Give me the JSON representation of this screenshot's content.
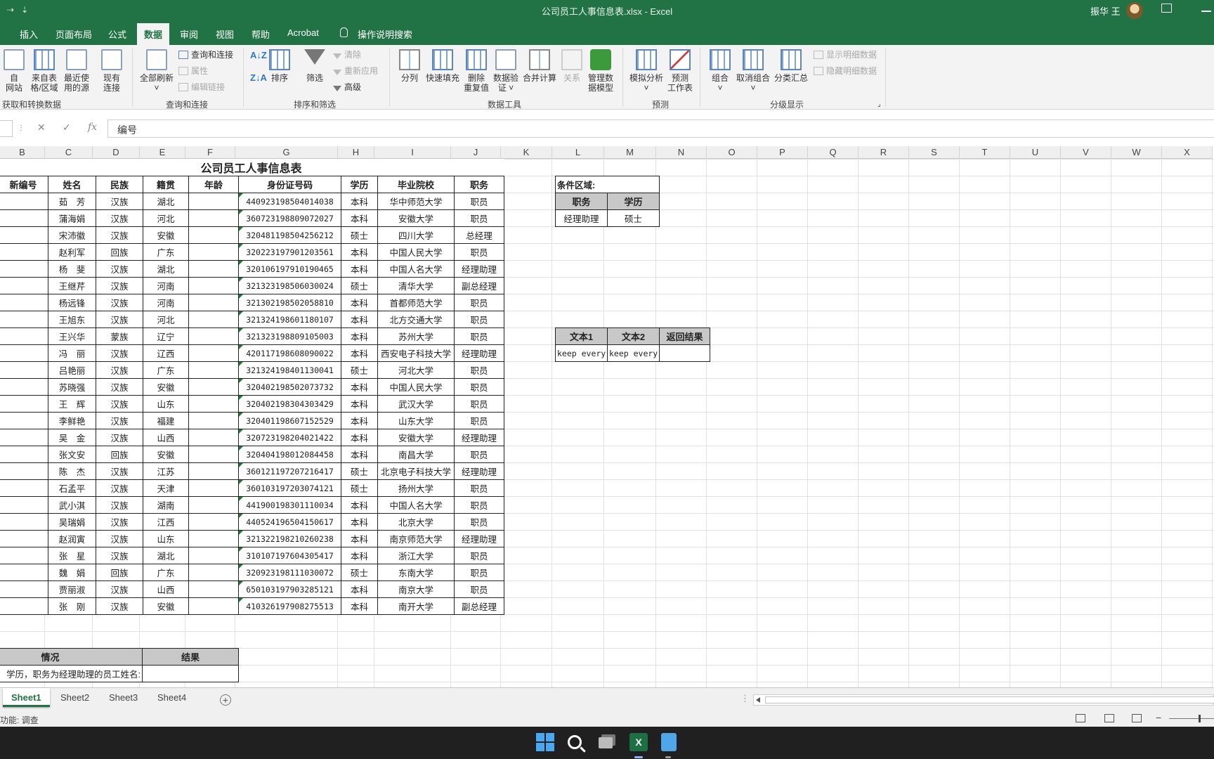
{
  "window": {
    "title": "公司员工人事信息表.xlsx  -  Excel",
    "user": "振华 王"
  },
  "tabs": [
    "插入",
    "页面布局",
    "公式",
    "数据",
    "审阅",
    "视图",
    "帮助",
    "Acrobat",
    "操作说明搜索"
  ],
  "active_tab": "数据",
  "ribbon": {
    "get_data": {
      "web": "自\n网站",
      "table": "来自表\n格/区域",
      "recent": "最近使\n用的源",
      "existing": "现有\n连接",
      "label": "获取和转换数据"
    },
    "queries": {
      "refresh_all": "全部刷新",
      "queries_connections": "查询和连接",
      "properties": "属性",
      "edit_links": "编辑链接",
      "label": "查询和连接"
    },
    "sort_filter": {
      "sort": "排序",
      "filter": "筛选",
      "clear": "清除",
      "reapply": "重新应用",
      "advanced": "高级",
      "label": "排序和筛选"
    },
    "data_tools": {
      "text_to_columns": "分列",
      "flash_fill": "快速填充",
      "remove_dup": "删除\n重复值",
      "validation": "数据验\n证 ˅",
      "consolidate": "合并计算",
      "relationships": "关系",
      "data_model": "管理数\n据模型",
      "label": "数据工具"
    },
    "forecast": {
      "what_if": "模拟分析\n˅",
      "sheet": "预测\n工作表",
      "label": "预测"
    },
    "outline": {
      "group": "组合\n˅",
      "ungroup": "取消组合\n˅",
      "subtotal": "分类汇总",
      "show_detail": "显示明细数据",
      "hide_detail": "隐藏明细数据",
      "label": "分级显示"
    }
  },
  "formula_bar": {
    "content": "编号",
    "cancel": "✕",
    "enter": "✓",
    "fx": "fx"
  },
  "columns": [
    "B",
    "C",
    "D",
    "E",
    "F",
    "G",
    "H",
    "I",
    "J",
    "K",
    "L",
    "M",
    "N",
    "O",
    "P",
    "Q",
    "R",
    "S",
    "T",
    "U",
    "V",
    "W",
    "X"
  ],
  "main_table": {
    "title": "公司员工人事信息表",
    "headers": [
      "新编号",
      "姓名",
      "民族",
      "籍贯",
      "年龄",
      "身份证号码",
      "学历",
      "毕业院校",
      "职务"
    ],
    "rows": [
      [
        "",
        "茹　芳",
        "汉族",
        "湖北",
        "",
        "440923198504014038",
        "本科",
        "华中师范大学",
        "职员"
      ],
      [
        "",
        "蒲海娟",
        "汉族",
        "河北",
        "",
        "360723198809072027",
        "本科",
        "安徽大学",
        "职员"
      ],
      [
        "",
        "宋沛徽",
        "汉族",
        "安徽",
        "",
        "320481198504256212",
        "硕士",
        "四川大学",
        "总经理"
      ],
      [
        "",
        "赵利军",
        "回族",
        "广东",
        "",
        "320223197901203561",
        "本科",
        "中国人民大学",
        "职员"
      ],
      [
        "",
        "杨　斐",
        "汉族",
        "湖北",
        "",
        "320106197910190465",
        "本科",
        "中国人名大学",
        "经理助理"
      ],
      [
        "",
        "王继芹",
        "汉族",
        "河南",
        "",
        "321323198506030024",
        "硕士",
        "清华大学",
        "副总经理"
      ],
      [
        "",
        "杨远锋",
        "汉族",
        "河南",
        "",
        "321302198502058810",
        "本科",
        "首都师范大学",
        "职员"
      ],
      [
        "",
        "王旭东",
        "汉族",
        "河北",
        "",
        "321324198601180107",
        "本科",
        "北方交通大学",
        "职员"
      ],
      [
        "",
        "王兴华",
        "蒙族",
        "辽宁",
        "",
        "321323198809105003",
        "本科",
        "苏州大学",
        "职员"
      ],
      [
        "",
        "冯　丽",
        "汉族",
        "辽西",
        "",
        "420117198608090022",
        "本科",
        "西安电子科技大学",
        "经理助理"
      ],
      [
        "",
        "吕艳丽",
        "汉族",
        "广东",
        "",
        "321324198401130041",
        "硕士",
        "河北大学",
        "职员"
      ],
      [
        "",
        "苏晓强",
        "汉族",
        "安徽",
        "",
        "320402198502073732",
        "本科",
        "中国人民大学",
        "职员"
      ],
      [
        "",
        "王　辉",
        "汉族",
        "山东",
        "",
        "320402198304303429",
        "本科",
        "武汉大学",
        "职员"
      ],
      [
        "",
        "李鲜艳",
        "汉族",
        "福建",
        "",
        "320401198607152529",
        "本科",
        "山东大学",
        "职员"
      ],
      [
        "",
        "吴　金",
        "汉族",
        "山西",
        "",
        "320723198204021422",
        "本科",
        "安徽大学",
        "经理助理"
      ],
      [
        "",
        "张文安",
        "回族",
        "安徽",
        "",
        "320404198012084458",
        "本科",
        "南昌大学",
        "职员"
      ],
      [
        "",
        "陈　杰",
        "汉族",
        "江苏",
        "",
        "360121197207216417",
        "硕士",
        "北京电子科技大学",
        "经理助理"
      ],
      [
        "",
        "石孟平",
        "汉族",
        "天津",
        "",
        "360103197203074121",
        "硕士",
        "扬州大学",
        "职员"
      ],
      [
        "",
        "武小淇",
        "汉族",
        "湖南",
        "",
        "441900198301110034",
        "本科",
        "中国人名大学",
        "职员"
      ],
      [
        "",
        "吴瑞娟",
        "汉族",
        "江西",
        "",
        "440524196504150617",
        "本科",
        "北京大学",
        "职员"
      ],
      [
        "",
        "赵润寅",
        "汉族",
        "山东",
        "",
        "321322198210260238",
        "本科",
        "南京师范大学",
        "经理助理"
      ],
      [
        "",
        "张　星",
        "汉族",
        "湖北",
        "",
        "310107197604305417",
        "本科",
        "浙江大学",
        "职员"
      ],
      [
        "",
        "魏　娟",
        "回族",
        "广东",
        "",
        "320923198111030072",
        "硕士",
        "东南大学",
        "职员"
      ],
      [
        "",
        "贾丽淑",
        "汉族",
        "山西",
        "",
        "650103197903285121",
        "本科",
        "南京大学",
        "职员"
      ],
      [
        "",
        "张　刚",
        "汉族",
        "安徽",
        "",
        "410326197908275513",
        "本科",
        "南开大学",
        "副总经理"
      ]
    ]
  },
  "condition_area": {
    "title": "条件区域:",
    "headers": [
      "职务",
      "学历"
    ],
    "values": [
      "经理助理",
      "硕士"
    ]
  },
  "text_compare": {
    "headers": [
      "文本1",
      "文本2",
      "返回结果"
    ],
    "values": [
      "keep every",
      "keep every",
      ""
    ]
  },
  "query_table": {
    "headers": [
      "情况",
      "结果"
    ],
    "question": "学历，职务为经理助理的员工姓名:",
    "result": ""
  },
  "sheets": [
    "Sheet1",
    "Sheet2",
    "Sheet3",
    "Sheet4"
  ],
  "active_sheet": "Sheet1",
  "status": {
    "text": "功能: 调查"
  }
}
